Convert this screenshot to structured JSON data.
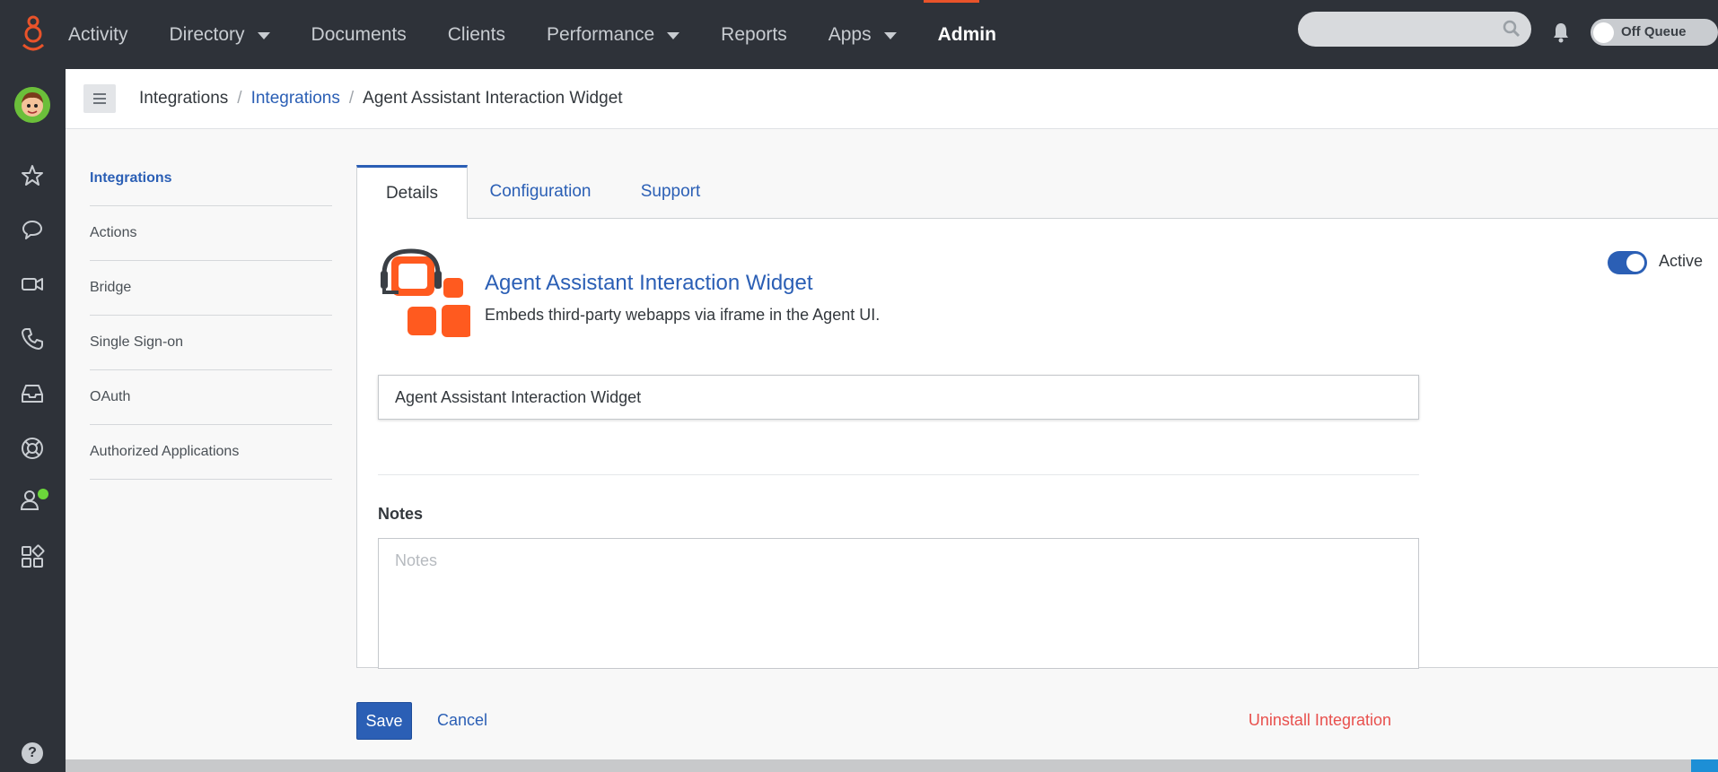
{
  "app": {
    "nav": {
      "items": [
        {
          "label": "Activity",
          "caret": false
        },
        {
          "label": "Directory",
          "caret": true
        },
        {
          "label": "Documents",
          "caret": false
        },
        {
          "label": "Clients",
          "caret": false
        },
        {
          "label": "Performance",
          "caret": true
        },
        {
          "label": "Reports",
          "caret": false
        },
        {
          "label": "Apps",
          "caret": true
        },
        {
          "label": "Admin",
          "caret": false,
          "active": true
        }
      ]
    },
    "queue_status": "Off Queue",
    "accent_color": "#e9532a",
    "link_color": "#2b5fb5"
  },
  "rail": {
    "icons": [
      "star-icon",
      "chat-icon",
      "video-icon",
      "phone-icon",
      "inbox-icon",
      "lifebuoy-icon",
      "agent-status-icon",
      "apps-grid-icon"
    ],
    "help_label": "?"
  },
  "breadcrumb": {
    "items": [
      "Integrations",
      "Integrations",
      "Agent Assistant Interaction Widget"
    ],
    "separator": "/"
  },
  "sidenav": {
    "items": [
      "Integrations",
      "Actions",
      "Bridge",
      "Single Sign-on",
      "OAuth",
      "Authorized Applications"
    ],
    "active_index": 0
  },
  "tabs": {
    "items": [
      "Details",
      "Configuration",
      "Support"
    ],
    "active_index": 0
  },
  "details": {
    "title": "Agent Assistant Interaction Widget",
    "description": "Embeds third-party webapps via iframe in the Agent UI.",
    "active_label": "Active",
    "active": true,
    "name_value": "Agent Assistant Interaction Widget",
    "notes_label": "Notes",
    "notes_placeholder": "Notes",
    "notes_value": ""
  },
  "actions": {
    "save": "Save",
    "cancel": "Cancel",
    "uninstall": "Uninstall Integration"
  }
}
